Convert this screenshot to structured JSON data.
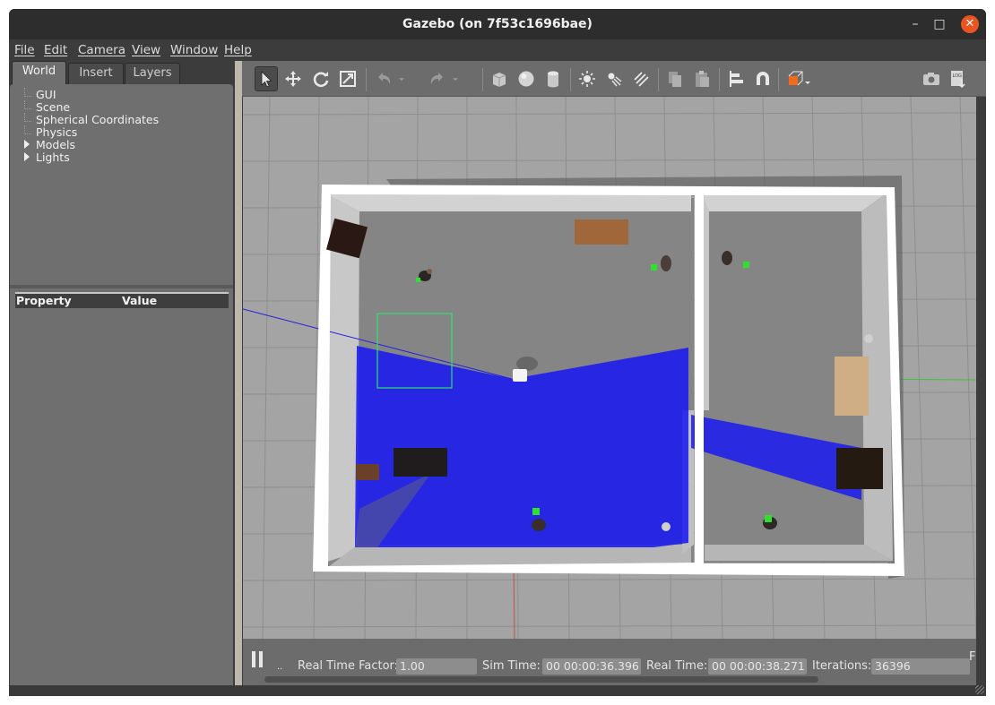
{
  "window": {
    "title": "Gazebo (on 7f53c1696bae)"
  },
  "window_controls": {
    "minimize": "–",
    "maximize": "□",
    "close": "✕"
  },
  "menu": [
    "File",
    "Edit",
    "Camera",
    "View",
    "Window",
    "Help"
  ],
  "left_panel": {
    "tabs": [
      "World",
      "Insert",
      "Layers"
    ],
    "active_tab": "World",
    "tree": [
      "GUI",
      "Scene",
      "Spherical Coordinates",
      "Physics",
      "Models",
      "Lights"
    ],
    "property_header": {
      "property": "Property",
      "value": "Value"
    }
  },
  "toolbar": {
    "tools": [
      "select-mode-icon",
      "translate-mode-icon",
      "rotate-mode-icon",
      "scale-mode-icon",
      "undo-icon",
      "redo-icon",
      "box-shape-icon",
      "sphere-shape-icon",
      "cylinder-shape-icon",
      "point-light-icon",
      "spot-light-icon",
      "directional-light-icon",
      "copy-icon",
      "paste-icon",
      "align-icon",
      "snap-icon",
      "view-angle-icon",
      "screenshot-icon",
      "log-icon"
    ],
    "active_tool": "select-mode-icon",
    "log_label": "LOG"
  },
  "status": {
    "real_time_factor_label": "Real Time Factor:",
    "real_time_factor": "1.00",
    "sim_time_label": "Sim Time:",
    "sim_time": "00 00:00:36.396",
    "real_time_label": "Real Time:",
    "real_time": "00 00:00:38.271",
    "iterations_label": "Iterations:",
    "iterations": "36396",
    "truncated": "F",
    "step_label": ".."
  },
  "colors": {
    "accent": "#e95420",
    "laser": "#1a1af0",
    "viewport_bg": "#a4a4a4",
    "panel": "#6f6f6f"
  }
}
